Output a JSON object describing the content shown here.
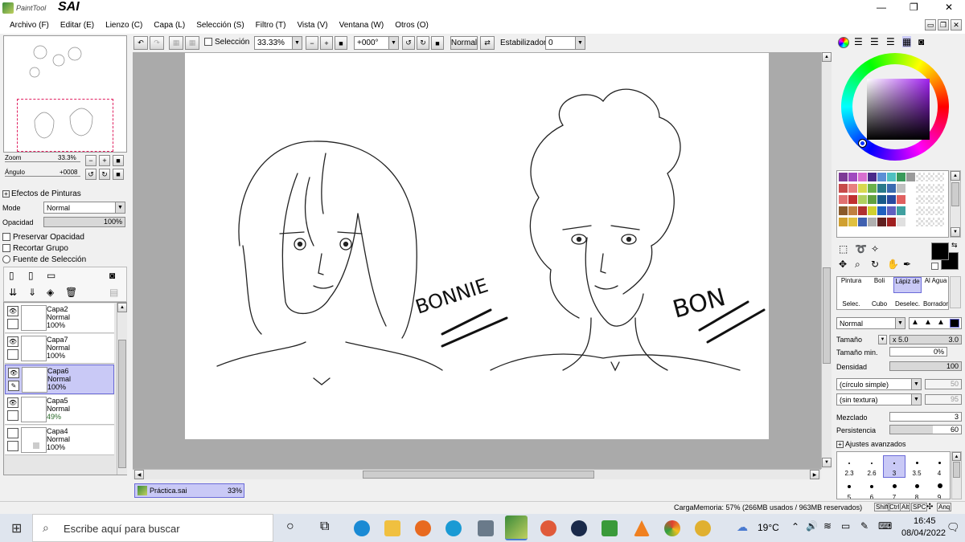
{
  "app": {
    "brand_small": "PaintTool",
    "brand_big": "SAI"
  },
  "window": {
    "minimize": "—",
    "restore": "❐",
    "close": "✕"
  },
  "menu": [
    "Archivo (F)",
    "Editar (E)",
    "Lienzo (C)",
    "Capa (L)",
    "Selección (S)",
    "Filtro (T)",
    "Vista (V)",
    "Ventana (W)",
    "Otros (O)"
  ],
  "navigator": {
    "zoom_label": "Zoom",
    "zoom_value": "33.3%",
    "angle_label": "Ángulo",
    "angle_value": "+0008"
  },
  "paint_effects": {
    "title": "Efectos de Pinturas"
  },
  "layer_props": {
    "mode_label": "Mode",
    "mode_value": "Normal",
    "opacity_label": "Opacidad",
    "opacity_value": "100%",
    "preserve_opacity": "Preservar Opacidad",
    "clip_group": "Recortar Grupo",
    "selection_source": "Fuente de Selección"
  },
  "layers": [
    {
      "name": "Capa2",
      "mode": "Normal",
      "opacity": "100%",
      "visible": true,
      "selected": false
    },
    {
      "name": "Capa7",
      "mode": "Normal",
      "opacity": "100%",
      "visible": true,
      "selected": false
    },
    {
      "name": "Capa6",
      "mode": "Normal",
      "opacity": "100%",
      "visible": true,
      "selected": true
    },
    {
      "name": "Capa5",
      "mode": "Normal",
      "opacity": "49%",
      "visible": true,
      "selected": false
    },
    {
      "name": "Capa4",
      "mode": "Normal",
      "opacity": "100%",
      "visible": false,
      "selected": false
    }
  ],
  "toolbar": {
    "selection_label": "Selección",
    "zoom": "33.33%",
    "angle": "+000°",
    "blend": "Normal",
    "stabilizer_label": "Estabilizador",
    "stabilizer_value": "0"
  },
  "canvas": {
    "text_left": "BONNIE",
    "text_right": "BON"
  },
  "doc_tab": {
    "name": "Práctica.sai",
    "zoom": "33%"
  },
  "status": {
    "memory": "CargaMemoria: 57% (266MB usados / 963MB reservados)",
    "keys": [
      "Shift",
      "Ctrl",
      "Alt",
      "SPC",
      "Anq"
    ]
  },
  "tools": {
    "groups": [
      [
        "Pintura",
        "Boli",
        "Lápiz de",
        "Al Agua"
      ],
      [
        "Selec.",
        "Cubo",
        "Deselec.",
        "Borrador"
      ]
    ],
    "mode": "Normal",
    "size_label": "Tamaño",
    "size_mult": "x 5.0",
    "size_value": "3.0",
    "min_size_label": "Tamaño min.",
    "min_size_value": "0%",
    "density_label": "Densidad",
    "density_value": "100",
    "shape": "(círculo simple)",
    "shape_value": "50",
    "texture": "(sin textura)",
    "texture_value": "95",
    "blend_label": "Mezclado",
    "blend_value": "3",
    "persistence_label": "Persistencia",
    "persistence_value": "60",
    "advanced": "Ajustes avanzados",
    "brush_sizes": [
      "2.3",
      "2.6",
      "3",
      "3.5",
      "4",
      "5",
      "6",
      "7",
      "8",
      "9"
    ]
  },
  "palette": [
    "#7d3a96",
    "#a04abf",
    "#d86fd0",
    "#4a2a8a",
    "#5b8fd6",
    "#4fc0c0",
    "#3a9a5a",
    "#9a9a9a",
    "#c74a4a",
    "#e88080",
    "#d8d850",
    "#6ab04a",
    "#2a7a8a",
    "#3a6ab0",
    "#c0c0c0",
    "#ffffff",
    "#e07070",
    "#c03030",
    "#b0d060",
    "#60a040",
    "#1a5a8a",
    "#2a4aa0",
    "#e06060",
    "#ffffff",
    "#8a5a2a",
    "#c08040",
    "#b03030",
    "#d0d030",
    "#2060c0",
    "#6060c0",
    "#40a0a0",
    "#ffffff",
    "#d0a030",
    "#e0c040",
    "#4060b0",
    "#b0b0b0",
    "#602020",
    "#a02020",
    "#e0e0e0",
    "#ffffff"
  ],
  "taskbar": {
    "search_placeholder": "Escribe aquí para buscar",
    "temperature": "19°C",
    "time": "16:45",
    "date": "08/04/2022"
  }
}
